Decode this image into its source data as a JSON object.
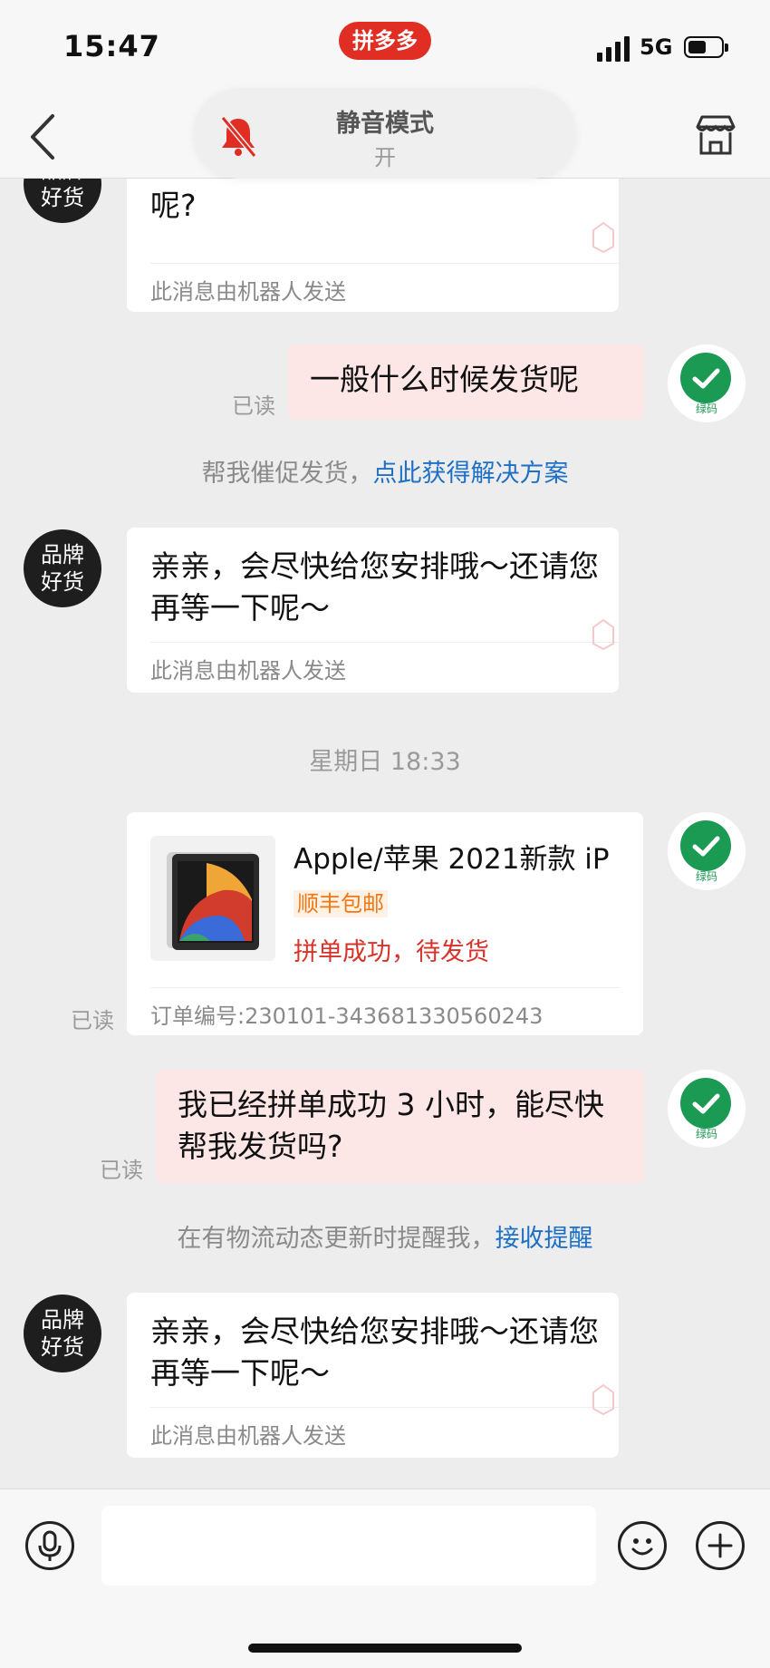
{
  "status_bar": {
    "time": "15:47",
    "app_badge": "拼多多",
    "network": "5G"
  },
  "nav": {
    "mute_title": "静音模式",
    "mute_state": "开"
  },
  "messages": {
    "m1": {
      "avatar": "品牌\n好货",
      "text": "亲，请问您的订单遇到什么问题了呢?",
      "footer": "此消息由机器人发送"
    },
    "m2": {
      "text": "一般什么时候发货呢",
      "read": "已读",
      "code": "绿码"
    },
    "m3": {
      "prefix": "帮我催促发货，",
      "link": "点此获得解决方案"
    },
    "m4": {
      "avatar": "品牌\n好货",
      "text": "亲亲，会尽快给您安排哦～还请您再等一下呢～",
      "footer": "此消息由机器人发送"
    },
    "timestamp": "星期日 18:33",
    "order": {
      "title": "Apple/苹果 2021新款 iP",
      "shipping": "顺丰包邮",
      "status": "拼单成功，待发货",
      "order_no": "订单编号:230101-343681330560243",
      "read": "已读",
      "code": "绿码"
    },
    "m6": {
      "text": "我已经拼单成功 3 小时，能尽快帮我发货吗?",
      "read": "已读",
      "code": "绿码"
    },
    "m7": {
      "prefix": "在有物流动态更新时提醒我，",
      "link": "接收提醒"
    },
    "m8": {
      "avatar": "品牌\n好货",
      "text": "亲亲，会尽快给您安排哦～还请您再等一下呢～",
      "footer": "此消息由机器人发送"
    }
  },
  "colors": {
    "brand": "#e02e24",
    "link": "#1d70c6",
    "green_code": "#1b9a54",
    "my_bubble": "#fde6e6"
  },
  "icons": [
    "back-arrow-icon",
    "muted-bell-icon",
    "shop-icon",
    "check-icon",
    "microphone-icon",
    "emoji-icon",
    "plus-icon",
    "tablet-image"
  ]
}
